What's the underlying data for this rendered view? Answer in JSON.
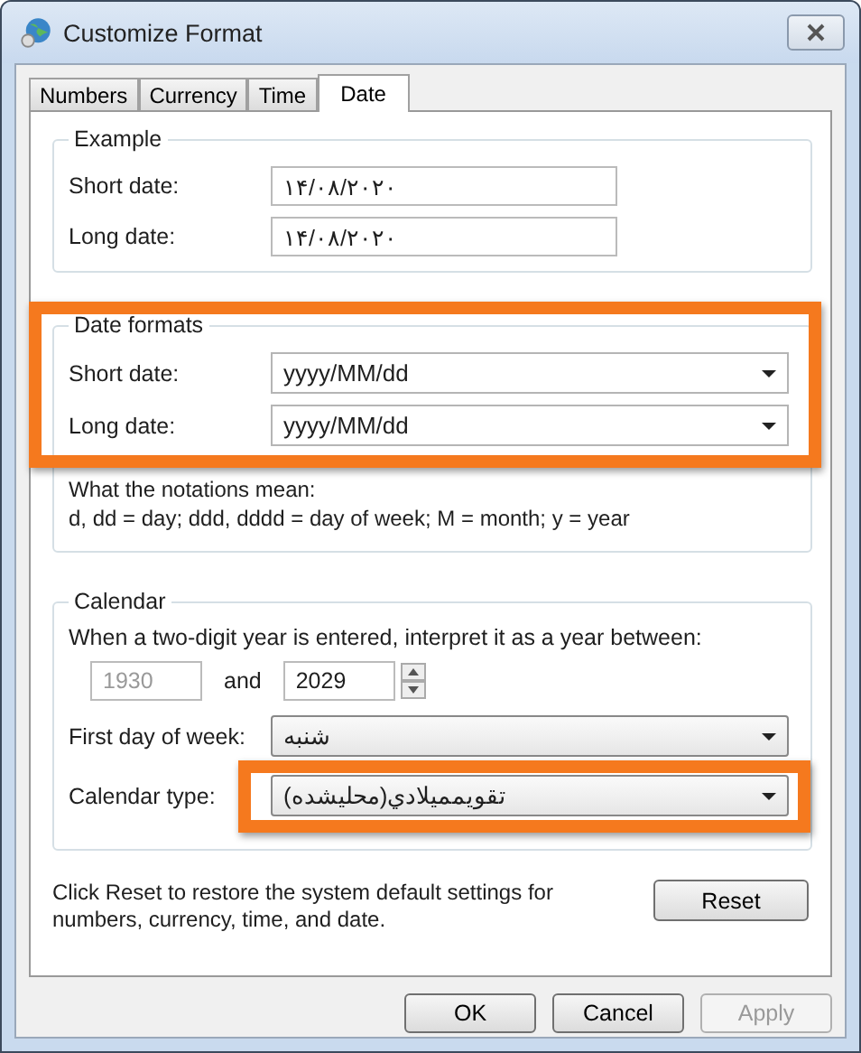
{
  "window": {
    "title": "Customize Format"
  },
  "tabs": [
    {
      "label": "Numbers",
      "selected": false
    },
    {
      "label": "Currency",
      "selected": false
    },
    {
      "label": "Time",
      "selected": false
    },
    {
      "label": "Date",
      "selected": true
    }
  ],
  "example": {
    "title": "Example",
    "fields": [
      {
        "label": "Short date:",
        "value": "۱۴/۰۸/۲۰۲۰"
      },
      {
        "label": "Long date:",
        "value": "۱۴/۰۸/۲۰۲۰"
      }
    ]
  },
  "date_formats": {
    "title": "Date formats",
    "highlighted": true,
    "fields": [
      {
        "label": "Short date:",
        "value": "yyyy/MM/dd"
      },
      {
        "label": "Long date:",
        "value": "yyyy/MM/dd"
      }
    ],
    "notes": [
      "What the notations mean:",
      "d, dd = day;  ddd, dddd = day of week;  M = month;  y = year"
    ]
  },
  "calendar": {
    "title": "Calendar",
    "two_digit_label": "When a two-digit year is entered, interpret it as a year between:",
    "year_from": {
      "value": "1930",
      "disabled": true
    },
    "and_label": "and",
    "year_to": {
      "value": "2029",
      "disabled": false
    },
    "selects": [
      {
        "label": "First day of week:",
        "value": "شنبه",
        "highlighted": false
      },
      {
        "label": "Calendar type:",
        "value": "تقويممیلادي(محليشده)",
        "highlighted": true
      }
    ]
  },
  "reset": {
    "text": "Click Reset to restore the system default settings for numbers, currency, time, and date.",
    "button": "Reset"
  },
  "buttons": [
    {
      "label": "OK",
      "disabled": false
    },
    {
      "label": "Cancel",
      "disabled": false
    },
    {
      "label": "Apply",
      "disabled": true
    }
  ]
}
